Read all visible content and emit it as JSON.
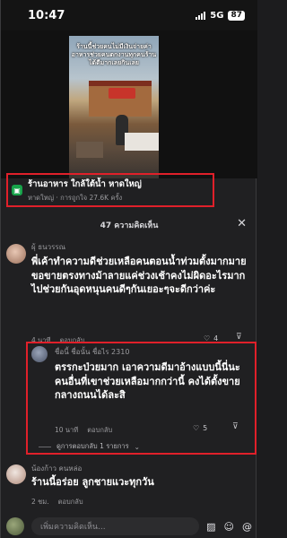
{
  "status_bar": {
    "time": "10:47",
    "network": "5G",
    "battery": "87"
  },
  "video": {
    "overlay_text": "ร้านนี้ช่วยคนไม่มีเงินจ่ายค่าอาหารช่วยคนตกงานทุกคนร้านได้ดีมากเลยกินเลย"
  },
  "source": {
    "title": "ร้านอาหาร ใกล้ใต้น้ำ หาดใหญ่",
    "meta": "หาดใหญ่ · การถูกใจ 27.6K ครั้ง"
  },
  "comments_header": {
    "label": "47 ความคิดเห็น",
    "close_icon": "close-icon"
  },
  "comments": [
    {
      "username": "ผุ้ ธนวรรณ",
      "body": "พี่เค้าทำความดีช่วยเหลือคนตอนน้ำท่วมตั้งมากมายขอขายตรงทางม้าลายแค่ช่วงเช้าคงไม่ผิดอะไรมากไปช่วยกันอุดหนุนคนดีๆกันเยอะๆจะดีกว่าค่ะ",
      "time": "4 นาที",
      "reply_label": "ตอบกลับ",
      "likes": "4"
    },
    {
      "username": "ชื่อนี้ ชื่อนั้น ชื่อไร 2310",
      "body": "ตรรกะป่วยมาก เอาความดีมาอ้างแบบนี้นี่นะ คนอื่นที่เขาช่วยเหลือมากกว่านี้ คงได้ตั้งขายกลางถนนได้ละสิ",
      "time": "10 นาที",
      "reply_label": "ตอบกลับ",
      "likes": "5",
      "replies_label": "ดูการตอบกลับ 1 รายการ"
    },
    {
      "username": "น้องก้าว คนหล่อ",
      "body": "ร้านนี้อร่อย ลูกชายแวะทุกวัน",
      "time": "2 ชม.",
      "reply_label": "ตอบกลับ"
    }
  ],
  "input": {
    "placeholder": "เพิ่มความคิดเห็น..."
  },
  "colors": {
    "highlight": "#e0202a",
    "app_icon": "#17a34a"
  }
}
